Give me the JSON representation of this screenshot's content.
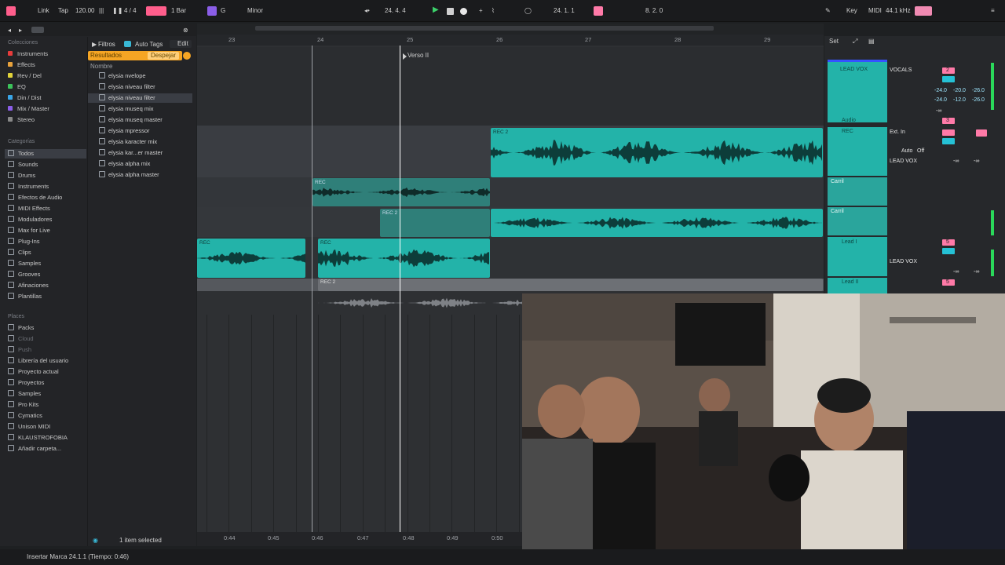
{
  "topbar": {
    "link": "Link",
    "tap": "Tap",
    "tempo": "120.00",
    "signature": "4 / 4",
    "quantize": "1 Bar",
    "scale_root": "G",
    "scale_mode": "Minor",
    "position": "24.   4.   4",
    "loop_start": "24.   1.   1",
    "loop_length": "8.   2.   0",
    "key": "Key",
    "midi": "MIDI",
    "sample_rate": "44.1 kHz"
  },
  "browser": {
    "collections_heading": "Colecciones",
    "collections": [
      {
        "label": "Instruments",
        "color": "#e83c3c"
      },
      {
        "label": "Effects",
        "color": "#e8a23c"
      },
      {
        "label": "Rev / Del",
        "color": "#e0d23a"
      },
      {
        "label": "EQ",
        "color": "#3cc35a"
      },
      {
        "label": "Din / Dist",
        "color": "#3aa6e8"
      },
      {
        "label": "Mix / Master",
        "color": "#8b5ee8"
      },
      {
        "label": "Stereo",
        "color": "#888888"
      }
    ],
    "categories_heading": "Categorías",
    "categories": [
      "Todos",
      "Sounds",
      "Drums",
      "Instruments",
      "Efectos de Audio",
      "MIDI Effects",
      "Moduladores",
      "Max for Live",
      "Plug-Ins",
      "Clips",
      "Samples",
      "Grooves",
      "Afinaciones",
      "Plantillas"
    ],
    "places_heading": "Places",
    "places": [
      "Packs",
      "Cloud",
      "Push",
      "Librería del usuario",
      "Proyecto actual",
      "Proyectos",
      "Samples",
      "Pro Kits",
      "Cymatics",
      "Unison MIDI",
      "KLAUSTROFOBIA",
      "Añadir carpeta..."
    ],
    "filter_button": "Filtros",
    "autotags_button": "Auto Tags",
    "edit_button": "Edit",
    "results_label": "Resultados",
    "clear_button": "Despejar",
    "name_column": "Nombre",
    "items": [
      "elysia nvelope",
      "elysia niveau filter",
      "elysia niveau filter",
      "elysia museq mix",
      "elysia museq master",
      "elysia mpressor",
      "elysia karacter mix",
      "elysia kar...er master",
      "elysia alpha mix",
      "elysia alpha master"
    ],
    "selection_info": "1 item selected"
  },
  "arrangement": {
    "bars": [
      "23",
      "24",
      "25",
      "26",
      "27",
      "28",
      "29"
    ],
    "locator": "Verso II",
    "clip_names": {
      "lead_a": "REC 2",
      "rec_b": "REC",
      "rec2_c": "REC 2",
      "rec_d1": "REC",
      "rec_d2": "REC",
      "rec2_e": "REC 2"
    },
    "time_ruler": [
      "0:44",
      "0:45",
      "0:46",
      "0:47",
      "0:48",
      "0:49",
      "0:50"
    ]
  },
  "mixer": {
    "set_label": "Set",
    "tracks": [
      {
        "name": "LEAD VOX",
        "route": "VOCALS"
      },
      {
        "name": "Audio",
        "route": ""
      },
      {
        "name": "REC",
        "route": "Ext. In"
      },
      {
        "name": "Carril",
        "route": ""
      },
      {
        "name": "Carril",
        "route": ""
      },
      {
        "name": "Lead I",
        "route": "LEAD VOX"
      },
      {
        "name": "Lead II",
        "route": ""
      }
    ],
    "monitor_auto": "Auto",
    "monitor_off": "Off",
    "lead_vox_output": "LEAD VOX",
    "vol_values": [
      "-24.0",
      "-20.0",
      "-26.0",
      "-24.0",
      "-12.0",
      "-26.0"
    ],
    "track_numbers": [
      "2",
      "3",
      "5",
      "5"
    ],
    "inf": "-∞"
  },
  "status": {
    "message": "Insertar Marca 24.1.1 (Tiempo: 0:46)"
  },
  "colors": {
    "clip": "#23b3a9",
    "clip_dim": "#1f7e78",
    "accent_pink": "#ff7aa8",
    "accent_orange": "#f5a524"
  }
}
